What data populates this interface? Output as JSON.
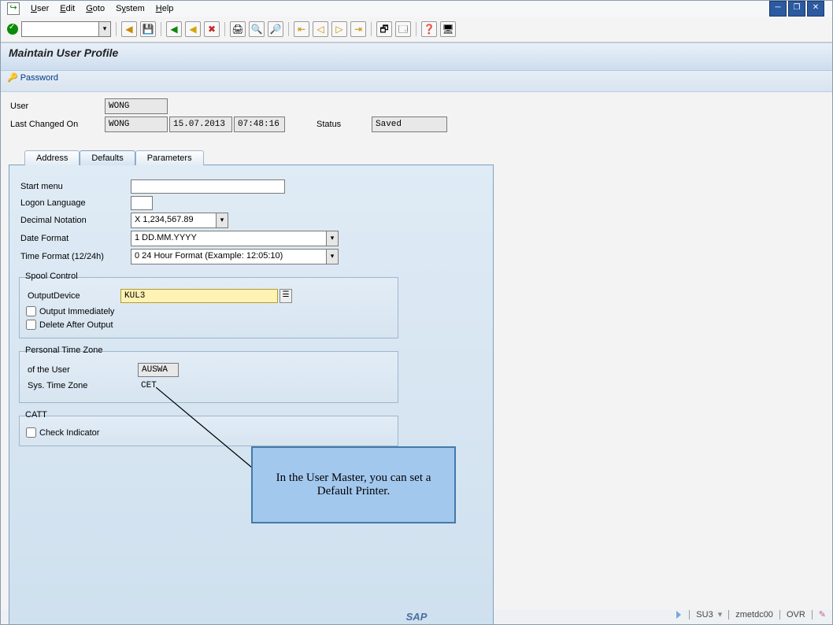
{
  "menu": {
    "user": "User",
    "edit": "Edit",
    "goto": "Goto",
    "system": "System",
    "help": "Help"
  },
  "title": "Maintain User Profile",
  "password_button": "Password",
  "header": {
    "user_label": "User",
    "user_value": "WONG",
    "last_changed_label": "Last Changed On",
    "last_changed_by": "WONG",
    "last_changed_date": "15.07.2013",
    "last_changed_time": "07:48:16",
    "status_label": "Status",
    "status_value": "Saved"
  },
  "tabs": {
    "address": "Address",
    "defaults": "Defaults",
    "parameters": "Parameters"
  },
  "defaults": {
    "start_menu_label": "Start menu",
    "start_menu_value": "",
    "logon_language_label": "Logon Language",
    "logon_language_value": "",
    "decimal_notation_label": "Decimal Notation",
    "decimal_notation_value": "X 1,234,567.89",
    "date_format_label": "Date Format",
    "date_format_value": "1 DD.MM.YYYY",
    "time_format_label": "Time Format (12/24h)",
    "time_format_value": "0 24 Hour Format (Example: 12:05:10)"
  },
  "spool": {
    "group_label": "Spool Control",
    "output_device_label": "OutputDevice",
    "output_device_value": "KUL3",
    "output_immediately_label": "Output Immediately",
    "output_immediately_checked": false,
    "delete_after_output_label": "Delete After Output",
    "delete_after_output_checked": false
  },
  "timezone": {
    "group_label": "Personal Time Zone",
    "of_user_label": "of the User",
    "of_user_value": "AUSWA",
    "sys_tz_label": "Sys. Time Zone",
    "sys_tz_value": "CET"
  },
  "catt": {
    "group_label": "CATT",
    "check_indicator_label": "Check Indicator",
    "check_indicator_checked": false
  },
  "callout": "In the User Master, you can set a Default Printer.",
  "status": {
    "tcode": "SU3",
    "system": "zmetdc00",
    "mode": "OVR"
  },
  "sap_logo": "SAP"
}
